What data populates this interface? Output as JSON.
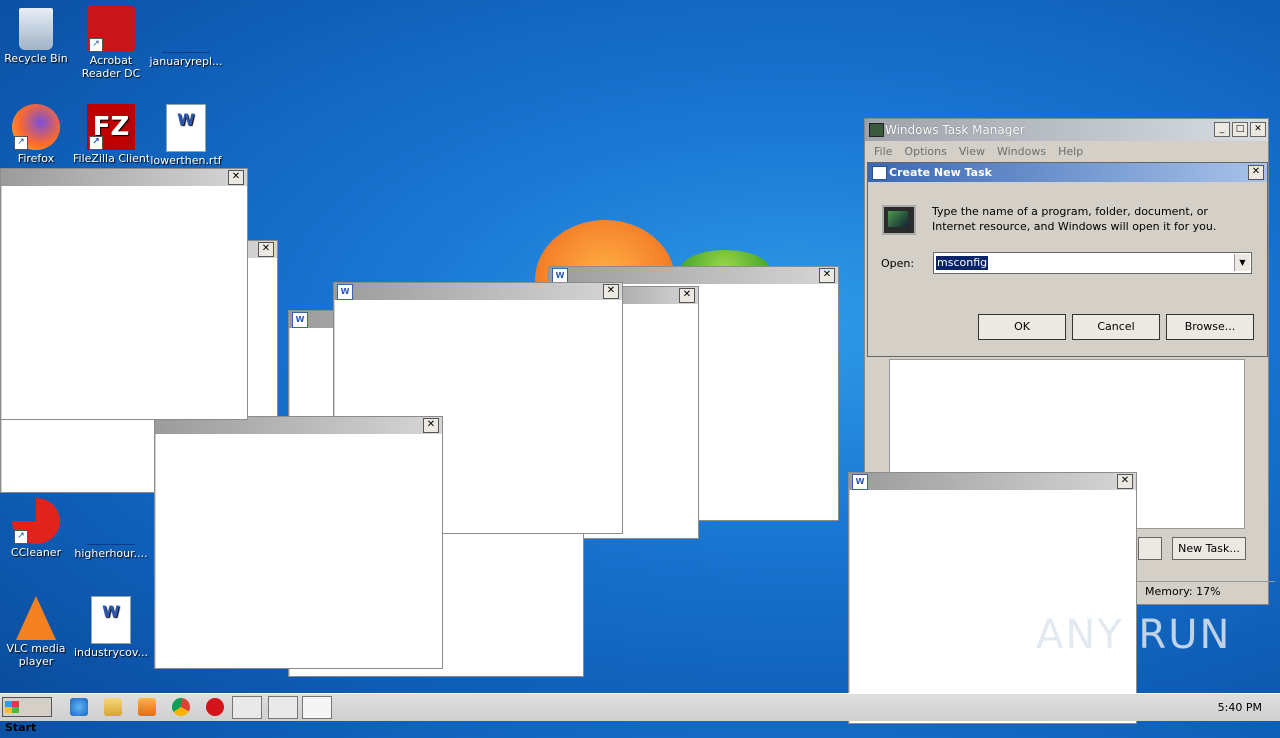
{
  "desktop": {
    "icons": [
      {
        "label": "Recycle Bin",
        "icon": "recycle-bin-icon"
      },
      {
        "label": "Acrobat Reader DC",
        "icon": "acrobat-icon"
      },
      {
        "label": "januaryrepl...",
        "icon": "file-icon"
      },
      {
        "label": "Firefox",
        "icon": "firefox-icon"
      },
      {
        "label": "FileZilla Client",
        "icon": "filezilla-icon"
      },
      {
        "label": "lowerthen.rtf",
        "icon": "word-doc-icon"
      },
      {
        "label": "CCleaner",
        "icon": "ccleaner-icon"
      },
      {
        "label": "higherhour....",
        "icon": "file-icon"
      },
      {
        "label": "VLC media player",
        "icon": "vlc-icon"
      },
      {
        "label": "industrycov...",
        "icon": "word-doc-icon"
      }
    ]
  },
  "task_manager": {
    "title": "Windows Task Manager",
    "menu": [
      "File",
      "Options",
      "View",
      "Windows",
      "Help"
    ],
    "new_task_button": "New Task...",
    "memory": "Memory: 17%"
  },
  "run_dialog": {
    "title": "Create New Task",
    "description": "Type the name of a program, folder, document, or Internet resource, and Windows will open it for you.",
    "open_label": "Open:",
    "open_value": "msconfig",
    "ok": "OK",
    "cancel": "Cancel",
    "browse": "Browse..."
  },
  "taskbar": {
    "start_label": "Start",
    "clock": "5:40 PM"
  },
  "watermark": "ANY RUN",
  "colors": {
    "desktop_blue": "#1a78d4",
    "dialog_title": "#3b68b4",
    "selection": "#0a246a"
  }
}
